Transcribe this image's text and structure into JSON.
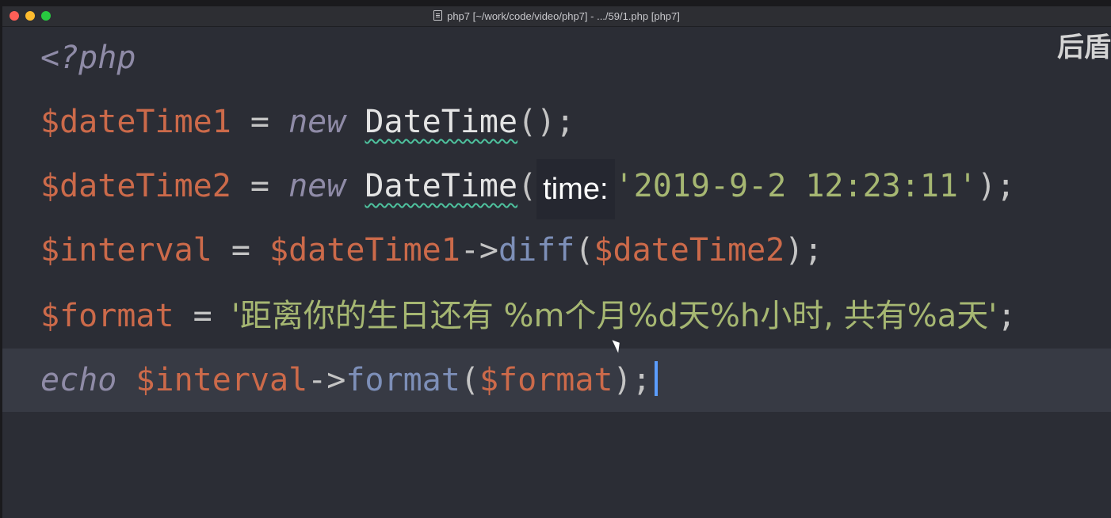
{
  "window": {
    "title": "php7 [~/work/code/video/php7] - .../59/1.php [php7]"
  },
  "overlay": {
    "text": "后盾"
  },
  "code": {
    "line1": {
      "open_tag": "<?php"
    },
    "line2": {
      "var": "$dateTime1",
      "eq": " = ",
      "kw": "new",
      "space": " ",
      "cls": "DateTime",
      "tail": "();"
    },
    "line3": {
      "var": "$dateTime2",
      "eq": " = ",
      "kw": "new",
      "space": " ",
      "cls": "DateTime",
      "paren_open": "(",
      "hint": "time:",
      "str": "'2019-9-2 12:23:11'",
      "tail": ");"
    },
    "line4": {
      "var1": "$interval",
      "eq": " = ",
      "var2": "$dateTime1",
      "arrow": "->",
      "fn": "diff",
      "paren_open": "(",
      "var3": "$dateTime2",
      "tail": ");"
    },
    "line5": {
      "var": "$format",
      "eq": " = ",
      "str": "'距离你的生日还有 %m个月%d天%h小时, 共有%a天'",
      "tail": ";"
    },
    "line6": {
      "kw": "echo",
      "space": " ",
      "var1": "$interval",
      "arrow": "->",
      "fn": "format",
      "paren_open": "(",
      "var2": "$format",
      "tail": ");"
    }
  }
}
